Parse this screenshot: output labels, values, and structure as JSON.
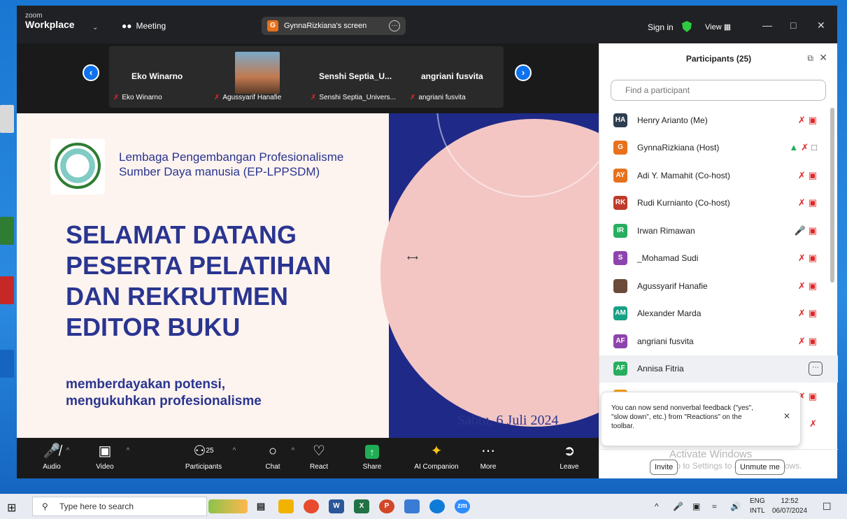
{
  "titlebar": {
    "brand_top": "zoom",
    "brand": "Workplace",
    "meeting_label": "Meeting",
    "screen_pill_letter": "G",
    "screen_pill_label": "GynnaRizkiana's screen",
    "sign_in": "Sign in",
    "view": "View"
  },
  "thumbnails": [
    {
      "name": "Eko Winarno",
      "label": "Eko Winarno"
    },
    {
      "name": "",
      "label": "Agussyarif Hanafie"
    },
    {
      "name": "Senshi Septia_U...",
      "label": "Senshi Septia_Univers..."
    },
    {
      "name": "angriani fusvita",
      "label": "angriani fusvita"
    }
  ],
  "slide": {
    "org_line1": "Lembaga Pengembangan Profesionalisme",
    "org_line2": "Sumber Daya manusia (EP-LPPSDM)",
    "headline": [
      "SELAMAT DATANG",
      "PESERTA PELATIHAN",
      "DAN REKRUTMEN",
      "EDITOR BUKU"
    ],
    "tagline1": "memberdayakan potensi,",
    "tagline2": "mengukuhkan profesionalisme",
    "date": "Sabtu, 6 Juli 2024"
  },
  "toolbar": {
    "audio": "Audio",
    "video": "Video",
    "participants": "Participants",
    "participants_count": "25",
    "chat": "Chat",
    "react": "React",
    "share": "Share",
    "ai_companion": "AI Companion",
    "more": "More",
    "leave": "Leave"
  },
  "panel": {
    "title": "Participants (25)",
    "search_placeholder": "Find a participant",
    "participants": [
      {
        "initials": "HA",
        "name": "Henry Arianto (Me)",
        "color": "#2d3e50"
      },
      {
        "initials": "G",
        "name": "GynnaRizkiana (Host)",
        "color": "#e8711c"
      },
      {
        "initials": "AY",
        "name": "Adi Y. Mamahit (Co-host)",
        "color": "#e8711c"
      },
      {
        "initials": "RK",
        "name": "Rudi Kurnianto (Co-host)",
        "color": "#c0392b"
      },
      {
        "initials": "IR",
        "name": "Irwan Rimawan",
        "color": "#27ae60"
      },
      {
        "initials": "S",
        "name": "_Mohamad Sudi",
        "color": "#8e44ad"
      },
      {
        "initials": "",
        "name": "Agussyarif Hanafie",
        "color": "#6b4a3a"
      },
      {
        "initials": "AM",
        "name": "Alexander Marda",
        "color": "#16a085"
      },
      {
        "initials": "AF",
        "name": "angriani fusvita",
        "color": "#8e44ad"
      },
      {
        "initials": "AF",
        "name": "Annisa Fitria",
        "color": "#27ae60"
      }
    ],
    "toast_text": "You can now send nonverbal feedback (\"yes\", \"slow down\", etc.) from \"Reactions\" on the toolbar.",
    "invite": "Invite",
    "unmute_me": "Unmute me",
    "activate_title": "Activate Windows",
    "activate_sub": "Go to Settings to activate Windows."
  },
  "taskbar": {
    "search_placeholder": "Type here to search",
    "lang1": "ENG",
    "lang2": "INTL",
    "time": "12:52",
    "date": "06/07/2024"
  },
  "colors": {
    "zoom_blue": "#0e72ed",
    "slide_navy": "#2a3590",
    "mute_red": "#e02828"
  }
}
